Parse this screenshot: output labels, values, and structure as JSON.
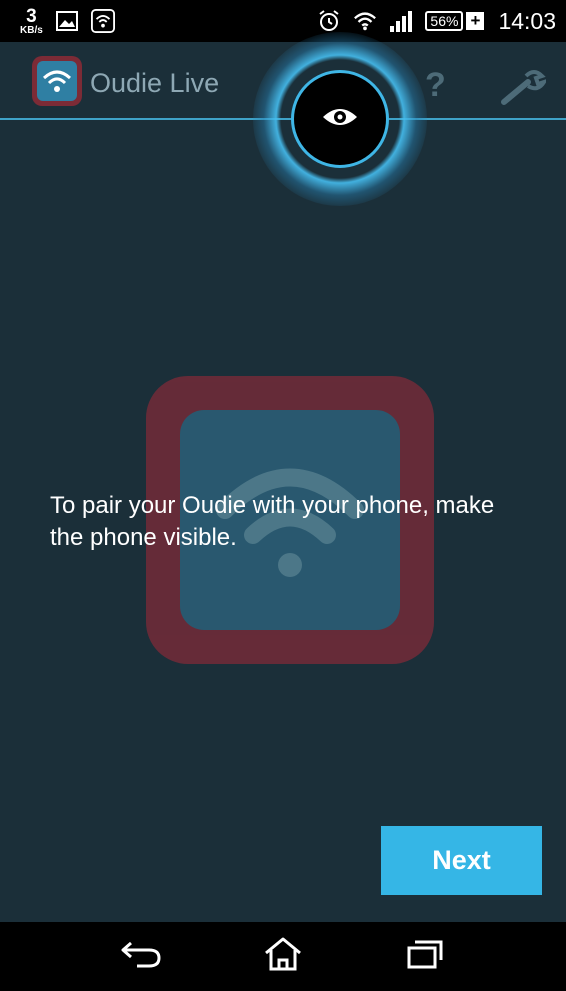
{
  "status_bar": {
    "speed_value": "3",
    "speed_unit": "KB/s",
    "battery_percent": "56%",
    "battery_plus": "+",
    "time": "14:03",
    "icons": [
      "image-icon",
      "wifi-hotspot-icon",
      "alarm-icon",
      "wifi-icon",
      "signal-icon",
      "battery-icon"
    ]
  },
  "action_bar": {
    "app_title": "Oudie Live",
    "help_label": "?",
    "icons": [
      "app-logo-icon",
      "eye-icon",
      "help-icon",
      "wrench-icon"
    ]
  },
  "content": {
    "instruction": "To pair your Oudie with your phone, make the phone visible.",
    "next_label": "Next"
  },
  "nav_bar": {
    "icons": [
      "back-icon",
      "home-icon",
      "recent-apps-icon"
    ]
  },
  "colors": {
    "background": "#1b2f39",
    "accent": "#35b6e6",
    "logo_frame": "#7c2b36",
    "logo_inner": "#2f7fa3"
  }
}
